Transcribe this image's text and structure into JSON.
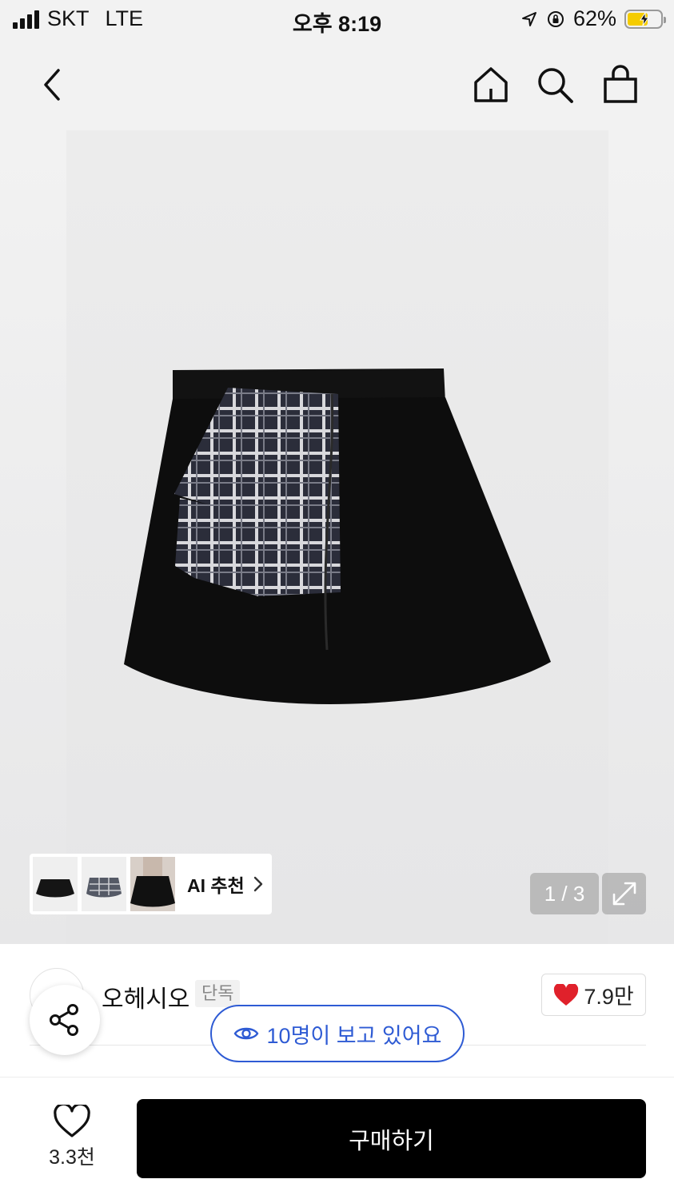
{
  "status_bar": {
    "carrier": "SKT",
    "network": "LTE",
    "time": "오후 8:19",
    "battery": "62%",
    "battery_level": 0.62,
    "signal_bars": 4
  },
  "nav": {
    "icons": [
      "back-chevron-icon",
      "home-icon",
      "search-icon",
      "shopping-bag-icon"
    ]
  },
  "gallery": {
    "ai_label": "AI 추천",
    "pager": "1 / 3",
    "current_image": 1,
    "total_images": 3
  },
  "product": {
    "brand": "오헤시오",
    "badge": "단독",
    "like_count": "7.9만",
    "viewers": "10명이 보고 있어요"
  },
  "bottom": {
    "wish_count": "3.3천",
    "buy_label": "구매하기"
  },
  "colors": {
    "accent_blue": "#2e5bd4",
    "heart_red": "#e0212b",
    "buy_button": "#000000",
    "battery_fill": "#f5cc00"
  }
}
